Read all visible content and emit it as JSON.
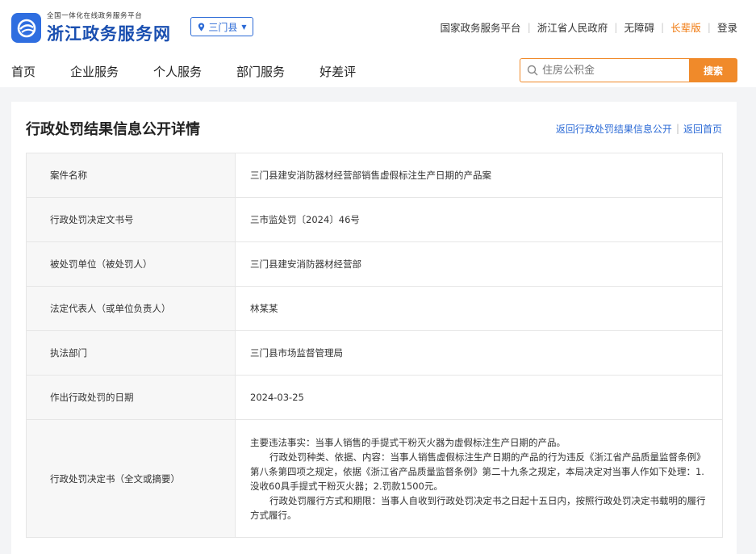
{
  "header": {
    "logo_sub": "全国一体化在线政务服务平台",
    "logo_main": "浙江政务服务网",
    "region": "三门县",
    "toplinks": [
      "国家政务服务平台",
      "浙江省人民政府",
      "无障碍",
      "长辈版",
      "登录"
    ]
  },
  "nav": [
    "首页",
    "企业服务",
    "个人服务",
    "部门服务",
    "好差评"
  ],
  "search": {
    "placeholder": "住房公积金",
    "button": "搜索"
  },
  "page": {
    "title": "行政处罚结果信息公开详情",
    "back_list": "返回行政处罚结果信息公开",
    "back_home": "返回首页"
  },
  "rows": [
    {
      "label": "案件名称",
      "value": "三门县建安消防器材经营部销售虚假标注生产日期的产品案"
    },
    {
      "label": "行政处罚决定文书号",
      "value": "三市监处罚〔2024〕46号"
    },
    {
      "label": "被处罚单位（被处罚人）",
      "value": "三门县建安消防器材经营部"
    },
    {
      "label": "法定代表人（或单位负责人）",
      "value": "林某某"
    },
    {
      "label": "执法部门",
      "value": "三门县市场监督管理局"
    },
    {
      "label": "作出行政处罚的日期",
      "value": "2024-03-25"
    }
  ],
  "decision": {
    "label": "行政处罚决定书（全文或摘要）",
    "p1": "主要违法事实：当事人销售的手提式干粉灭火器为虚假标注生产日期的产品。",
    "p2": "行政处罚种类、依据、内容：当事人销售虚假标注生产日期的产品的行为违反《浙江省产品质量监督条例》第八条第四项之规定，依据《浙江省产品质量监督条例》第二十九条之规定，本局决定对当事人作如下处理：1.没收60具手提式干粉灭火器；2.罚款1500元。",
    "p3": "行政处罚履行方式和期限：当事人自收到行政处罚决定书之日起十五日内，按照行政处罚决定书载明的履行方式履行。"
  },
  "colors": {
    "brand_blue": "#2b6ad6",
    "accent_orange": "#f08a2a"
  }
}
